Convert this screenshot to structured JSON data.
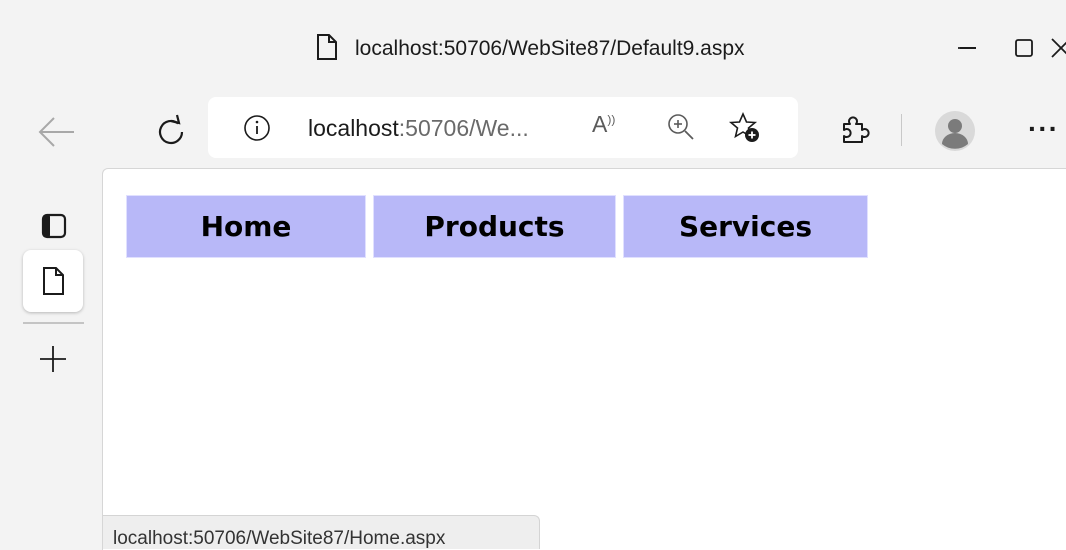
{
  "window": {
    "title": "localhost:50706/WebSite87/Default9.aspx"
  },
  "addressbar": {
    "url_host": "localhost",
    "url_rest": ":50706/We...",
    "readaloud_glyph": "A"
  },
  "menu": {
    "items": [
      {
        "label": "Home"
      },
      {
        "label": "Products"
      },
      {
        "label": "Services"
      }
    ],
    "background_color": "#b8b8f8"
  },
  "status": {
    "url": "localhost:50706/WebSite87/Home.aspx"
  },
  "toolbar": {
    "more_glyph": "···"
  },
  "icons": {
    "title": "page-icon",
    "back": "arrow-left-icon",
    "reload": "reload-icon",
    "info": "info-icon",
    "readaloud": "read-aloud-icon",
    "zoom": "zoom-in-icon",
    "favorite": "add-favorite-icon",
    "extensions": "extensions-icon",
    "profile": "profile-icon",
    "more": "more-icon",
    "tab_actions": "tab-actions-icon",
    "tab": "page-icon",
    "new_tab": "plus-icon"
  }
}
